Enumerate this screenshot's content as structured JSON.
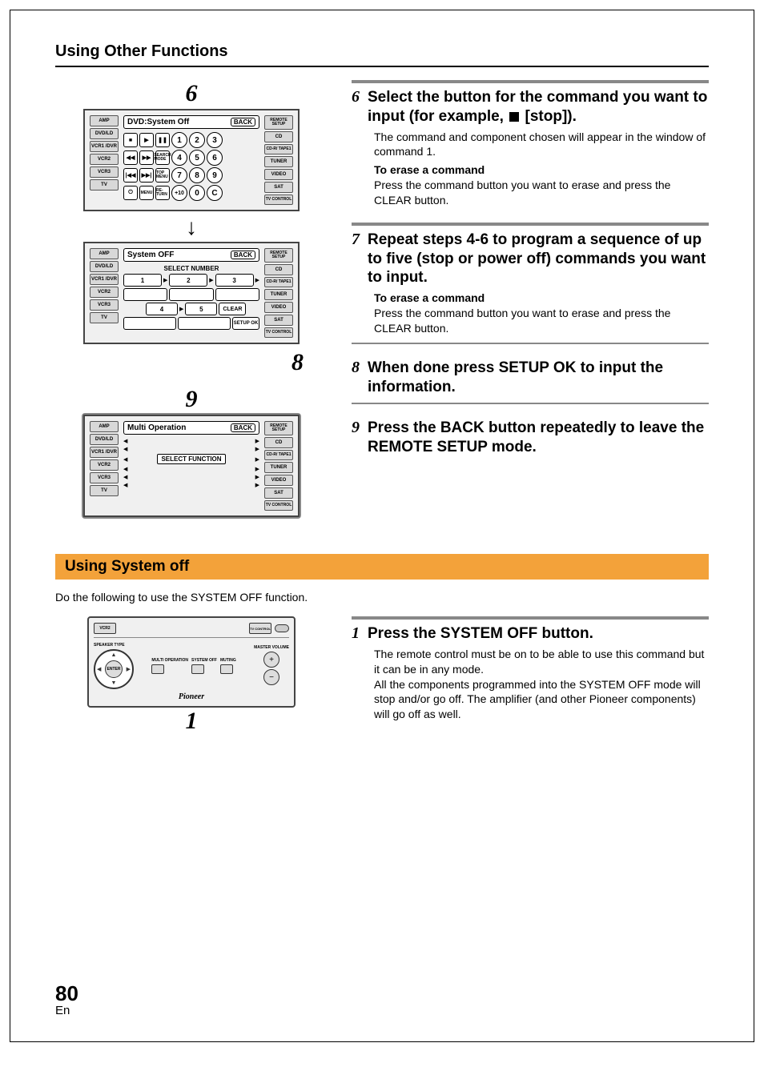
{
  "header": {
    "title": "Using Other Functions"
  },
  "callouts": {
    "c6": "6",
    "c8": "8",
    "c9": "9",
    "c1": "1"
  },
  "diagram1": {
    "lcd_title": "DVD:System Off",
    "lcd_back": "BACK",
    "left_side": [
      "AMP",
      "DVD/LD",
      "VCR1 /DVR",
      "VCR2",
      "VCR3",
      "TV"
    ],
    "right_side": [
      "REMOTE SETUP",
      "CD",
      "CD-R/ TAPE1",
      "TUNER",
      "VIDEO",
      "SAT",
      "TV CONTROL"
    ],
    "num_buttons": [
      "1",
      "2",
      "3",
      "4",
      "5",
      "6",
      "7",
      "8",
      "9",
      "+10",
      "0",
      "C"
    ],
    "text_buttons": [
      "SEARCH MODE",
      "TOP MENU",
      "MENU",
      "RE- TURN"
    ]
  },
  "diagram2": {
    "lcd_title": "System OFF",
    "lcd_back": "BACK",
    "select_label": "SELECT NUMBER",
    "left_side": [
      "AMP",
      "DVD/LD",
      "VCR1 /DVR",
      "VCR2",
      "VCR3",
      "TV"
    ],
    "right_side": [
      "REMOTE SETUP",
      "CD",
      "CD-R/ TAPE1",
      "TUNER",
      "VIDEO",
      "SAT",
      "TV CONTROL"
    ],
    "seq": [
      "1",
      "2",
      "3",
      "4",
      "5"
    ],
    "clear": "CLEAR",
    "setup_ok": "SETUP OK"
  },
  "diagram3": {
    "lcd_title": "Multi Operation",
    "lcd_back": "BACK",
    "select_label": "SELECT FUNCTION",
    "left_side": [
      "AMP",
      "DVD/LD",
      "VCR1 /DVR",
      "VCR2",
      "VCR3",
      "TV"
    ],
    "right_side": [
      "REMOTE SETUP",
      "CD",
      "CD-R/ TAPE1",
      "TUNER",
      "VIDEO",
      "SAT",
      "TV CONTROL"
    ]
  },
  "steps": {
    "s6": {
      "num": "6",
      "title_a": "Select the button for the command you want to input (for example, ",
      "title_b": " [stop]).",
      "body1": "The command and component chosen will appear in the window of command 1.",
      "sub": "To erase a command",
      "body2": "Press the command button you want to erase and press the CLEAR button."
    },
    "s7": {
      "num": "7",
      "title": "Repeat steps 4-6 to program a sequence of up to five (stop or power off) commands you want to input.",
      "sub": "To erase a command",
      "body": "Press the command button you want to erase and press the CLEAR button."
    },
    "s8": {
      "num": "8",
      "title": "When done press SETUP OK to input the information."
    },
    "s9": {
      "num": "9",
      "title": "Press the BACK button repeatedly to leave the REMOTE SETUP mode."
    }
  },
  "section2": {
    "heading": "Using System off",
    "intro": "Do the following to use the SYSTEM OFF function.",
    "step1": {
      "num": "1",
      "title": "Press the SYSTEM OFF button.",
      "body1": "The remote control must be on to be able to use this command but it can be in any mode.",
      "body2": "All the components programmed into the SYSTEM OFF mode will stop and/or go off. The amplifier (and other Pioneer components) will go off as well."
    }
  },
  "remote2": {
    "top_left": "VCR2",
    "top_right": "TV CONTROL",
    "speaker_type": "SPEAKER TYPE",
    "dpad_center": "ENTER",
    "btns": [
      "MULTI OPERATION",
      "SYSTEM OFF",
      "MUTING"
    ],
    "vol_label": "MASTER VOLUME",
    "brand": "Pioneer"
  },
  "page": {
    "num": "80",
    "lang": "En"
  }
}
